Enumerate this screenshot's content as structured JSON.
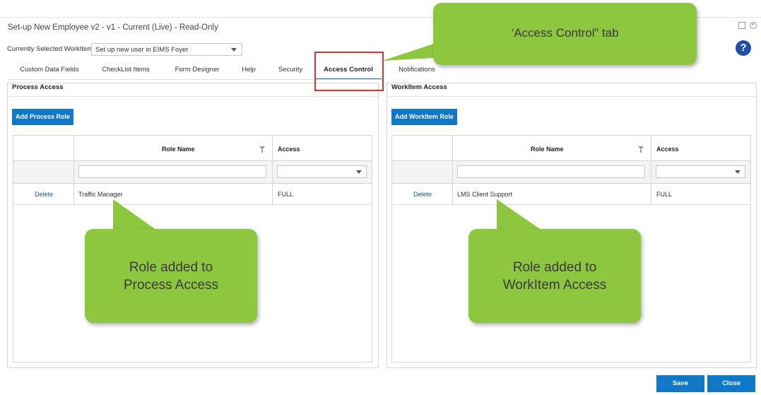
{
  "window": {
    "title": "Set-up New Employee v2 - v1 - Current (Live) - Read-Only",
    "help_glyph": "?"
  },
  "workitem": {
    "label": "Currently Selected WorkItem",
    "selected": "Set up new user in EIMS Foyer"
  },
  "tabs": [
    {
      "label": "Custom Data Fields",
      "active": false
    },
    {
      "label": "CheckList Items",
      "active": false
    },
    {
      "label": "Form Designer",
      "active": false
    },
    {
      "label": "Help",
      "active": false
    },
    {
      "label": "Security",
      "active": false
    },
    {
      "label": "Access Control",
      "active": true
    },
    {
      "label": "Notifications",
      "active": false
    }
  ],
  "process_access": {
    "title": "Process Access",
    "add_button": "Add Process Role",
    "columns": {
      "role": "Role Name",
      "access": "Access"
    },
    "rows": [
      {
        "action": "Delete",
        "role": "Traffic Manager",
        "access": "FULL"
      }
    ]
  },
  "workitem_access": {
    "title": "WorkItem Access",
    "add_button": "Add WorkItem Role",
    "columns": {
      "role": "Role Name",
      "access": "Access"
    },
    "rows": [
      {
        "action": "Delete",
        "role": "LMS Client Support",
        "access": "FULL"
      }
    ]
  },
  "callouts": {
    "tab": "‘Access Control” tab",
    "process_line1": "Role added to",
    "process_line2": "Process Access",
    "workitem_line1": "Role added to",
    "workitem_line2": "WorkItem Access"
  },
  "footer": {
    "save_label": "Save",
    "close_label": "Close"
  },
  "colors": {
    "accent_blue": "#1177c7",
    "callout_green": "#8dc63f",
    "highlight_red": "#e23030"
  },
  "icons": [
    "minimize-icon",
    "close-icon",
    "help-icon",
    "dropdown-caret-icon",
    "filter-icon"
  ]
}
